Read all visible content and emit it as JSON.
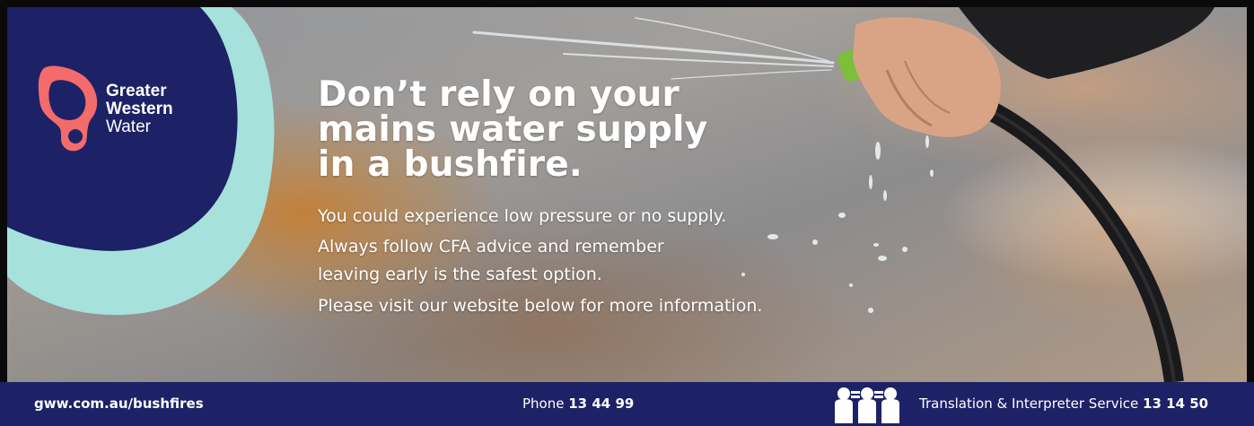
{
  "brand": {
    "name_line1": "Greater",
    "name_line2": "Western",
    "name_line3": "Water",
    "navy": "#1d2266",
    "aqua": "#a6e1dc",
    "coral": "#f36b6b"
  },
  "headline": {
    "line1": "Don’t rely on your",
    "line2": "mains water supply",
    "line3": "in a bushfire."
  },
  "body": {
    "line1": "You could experience low pressure or no supply.",
    "line2": "Always follow CFA advice and remember",
    "line3": "leaving early is the safest option.",
    "line4": "Please visit our website below for more information."
  },
  "footer": {
    "website": "gww.com.au/bushfires",
    "phone_label": "Phone",
    "phone_number": "13 44 99",
    "tis_label": "Translation & Interpreter Service",
    "tis_number": "13 14 50",
    "tis_icon": "interpreter-people-icon"
  },
  "photo": {
    "subject": "hand-holding-garden-hose-spraying-water-icon"
  }
}
